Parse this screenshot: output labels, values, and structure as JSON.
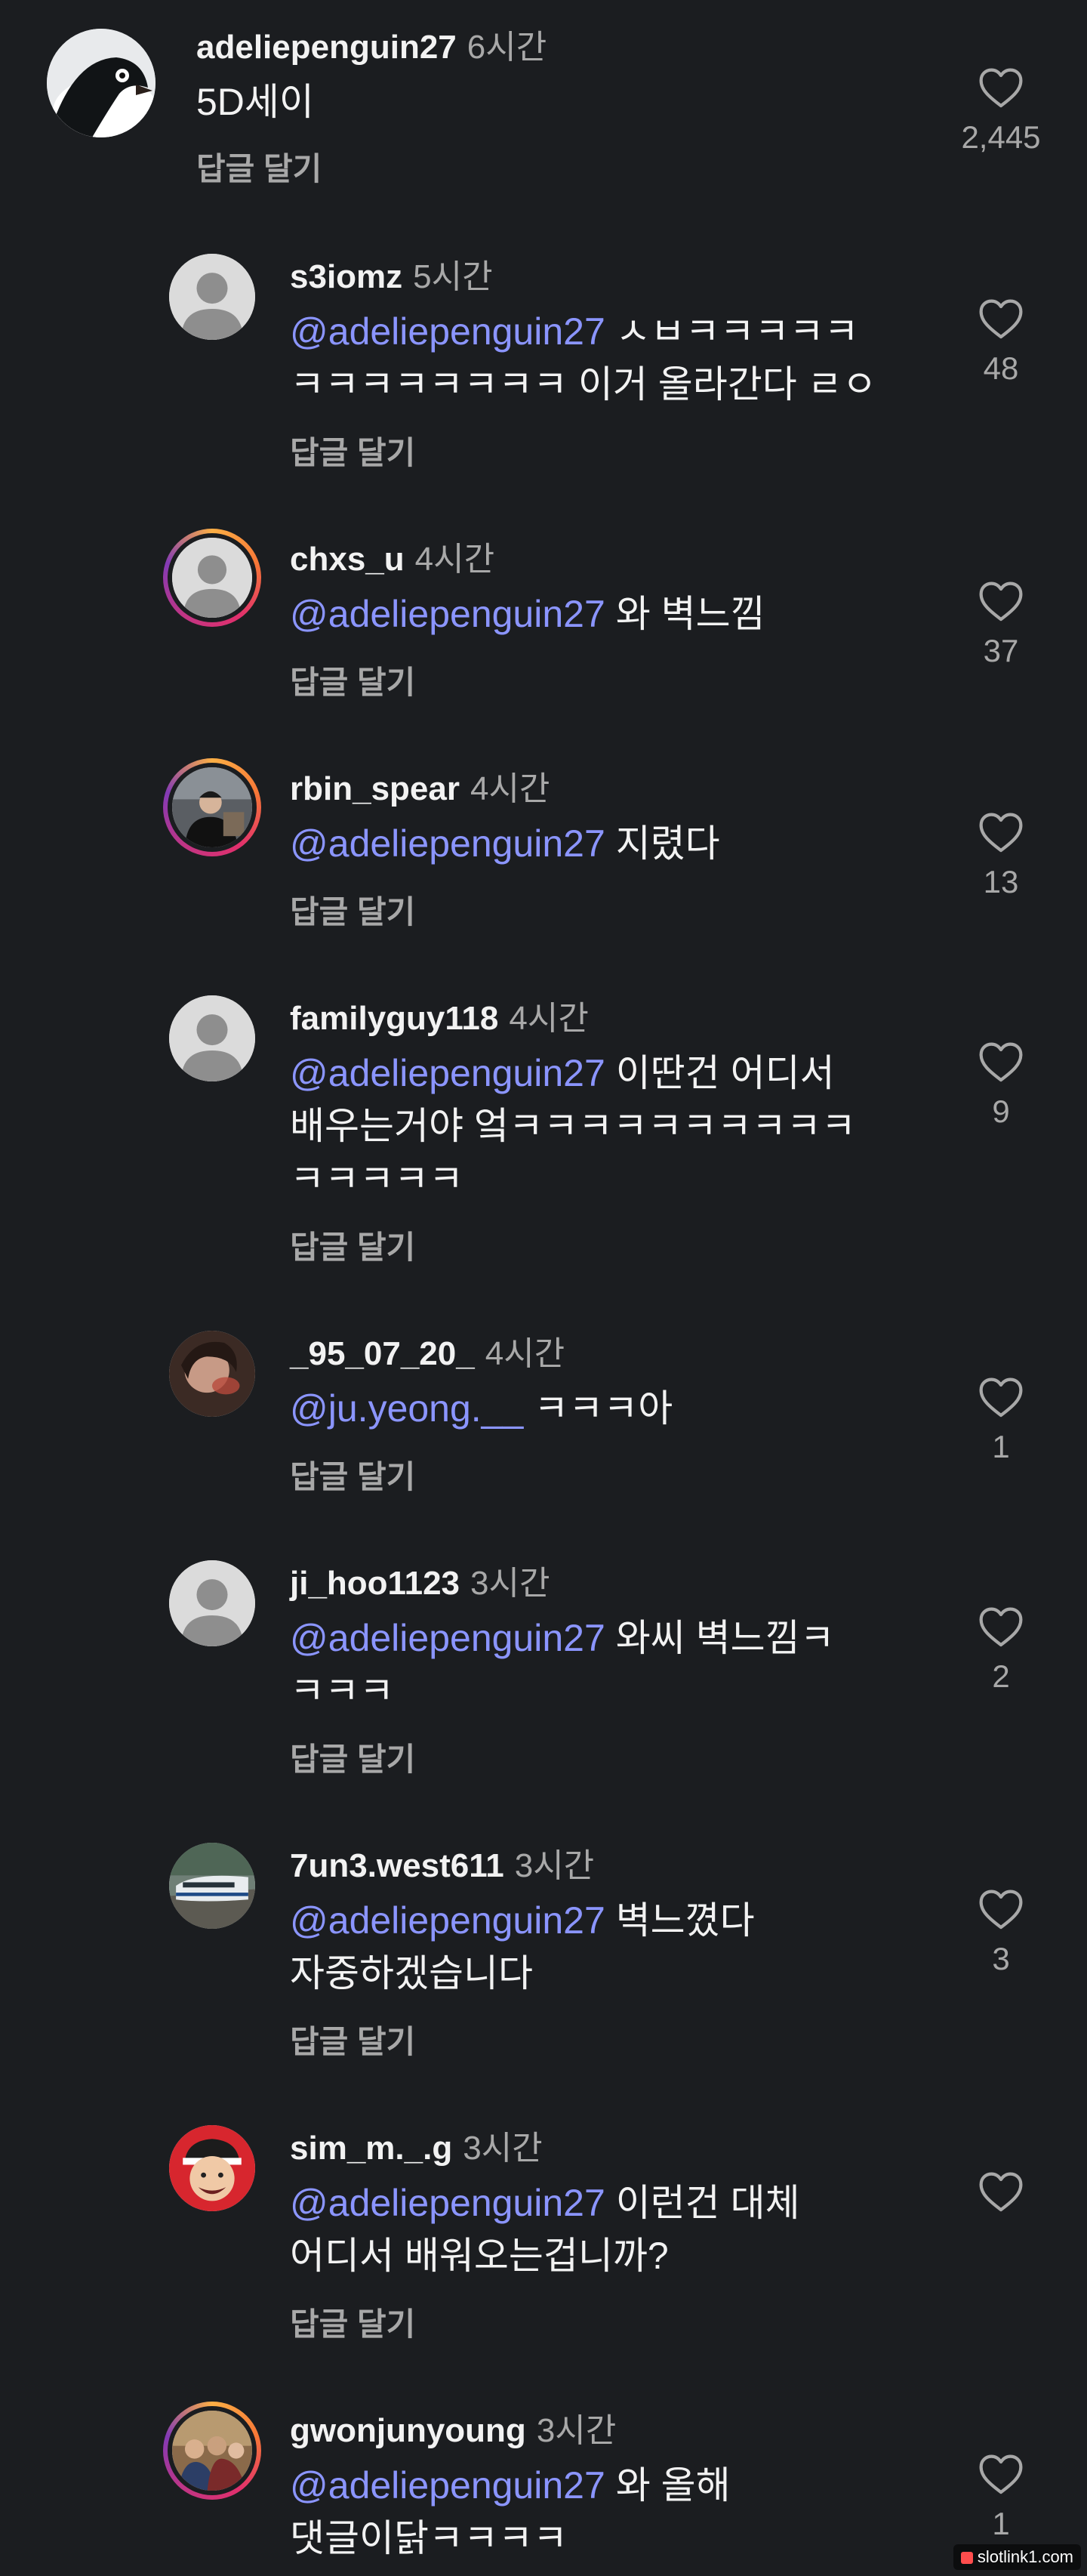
{
  "colors": {
    "background": "#1b1d20",
    "mention": "#8b95ff",
    "meta_text": "#a8a8a8",
    "primary_text": "#f2f2f2"
  },
  "reply_label": "답글 달기",
  "comments": [
    {
      "username": "adeliepenguin27",
      "time": "6시간",
      "mention": "",
      "lines": [
        "5D세이"
      ],
      "likes": "2,445",
      "avatar": "penguin-photo"
    },
    {
      "username": "s3iomz",
      "time": "5시간",
      "mention": "@adeliepenguin27",
      "lines": [
        "ㅅㅂㅋㅋㅋㅋㅋ",
        "ㅋㅋㅋㅋㅋㅋㅋㅋ 이거 올라간다 ㄹㅇ"
      ],
      "likes": "48",
      "avatar": "default-avatar"
    },
    {
      "username": "chxs_u",
      "time": "4시간",
      "mention": "@adeliepenguin27",
      "lines": [
        "와 벽느낌"
      ],
      "likes": "37",
      "avatar": "default-avatar-story-ring"
    },
    {
      "username": "rbin_spear",
      "time": "4시간",
      "mention": "@adeliepenguin27",
      "lines": [
        "지렸다"
      ],
      "likes": "13",
      "avatar": "person-photo-story-ring"
    },
    {
      "username": "familyguy118",
      "time": "4시간",
      "mention": "@adeliepenguin27",
      "lines": [
        "이딴건 어디서",
        "배우는거야 엌ㅋㅋㅋㅋㅋㅋㅋㅋㅋㅋ",
        "ㅋㅋㅋㅋㅋ"
      ],
      "likes": "9",
      "avatar": "default-avatar"
    },
    {
      "username": "_95_07_20_",
      "time": "4시간",
      "mention": "@ju.yeong.__",
      "lines": [
        "ㅋㅋㅋ아"
      ],
      "likes": "1",
      "avatar": "person-photo"
    },
    {
      "username": "ji_hoo1123",
      "time": "3시간",
      "mention": "@adeliepenguin27",
      "lines": [
        "와씨 벽느낌ㅋ",
        "ㅋㅋㅋ"
      ],
      "likes": "2",
      "avatar": "default-avatar"
    },
    {
      "username": "7un3.west611",
      "time": "3시간",
      "mention": "@adeliepenguin27",
      "lines": [
        "벽느꼈다",
        "자중하겠습니다"
      ],
      "likes": "3",
      "avatar": "train-photo"
    },
    {
      "username": "sim_m._.g",
      "time": "3시간",
      "mention": "@adeliepenguin27",
      "lines": [
        "이런건 대체",
        "어디서 배워오는겁니까?"
      ],
      "likes": "",
      "avatar": "cartoon-photo"
    },
    {
      "username": "gwonjunyoung",
      "time": "3시간",
      "mention": "@adeliepenguin27",
      "lines": [
        "와 올해",
        "댓글이닭ㅋㅋㅋㅋ"
      ],
      "likes": "1",
      "avatar": "group-photo-story-ring"
    }
  ],
  "watermark": "slotlink1.com"
}
